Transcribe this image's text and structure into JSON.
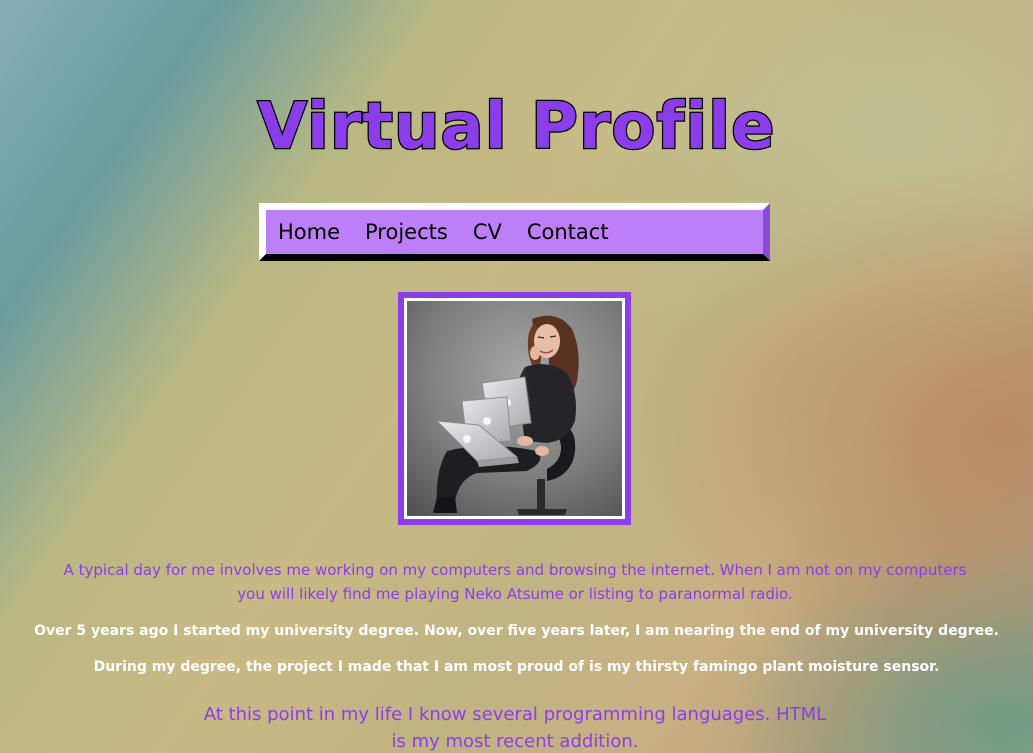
{
  "page": {
    "title": "Virtual Profile"
  },
  "nav": {
    "items": [
      {
        "label": "Home"
      },
      {
        "label": "Projects"
      },
      {
        "label": "CV"
      },
      {
        "label": "Contact"
      }
    ]
  },
  "profile_photo": {
    "alt": "Woman sitting in an office chair holding several laptops"
  },
  "content": {
    "intro": "A typical day for me involves me working on my computers and browsing the internet. When I am not on my computers you will likely find me playing Neko Atsume or listing to paranormal radio.",
    "degree": "Over 5 years ago I started my university degree. Now, over five years later, I am nearing the end of my university degree.",
    "project": "During my degree, the project I made that I am most proud of is my thirsty famingo plant moisture sensor.",
    "languages": "At this point in my life I know several programming languages. HTML is my most recent addition."
  },
  "colors": {
    "accent_purple": "#8c3dea",
    "nav_background": "#bd7ff8",
    "secondary_text": "#ffffff"
  }
}
